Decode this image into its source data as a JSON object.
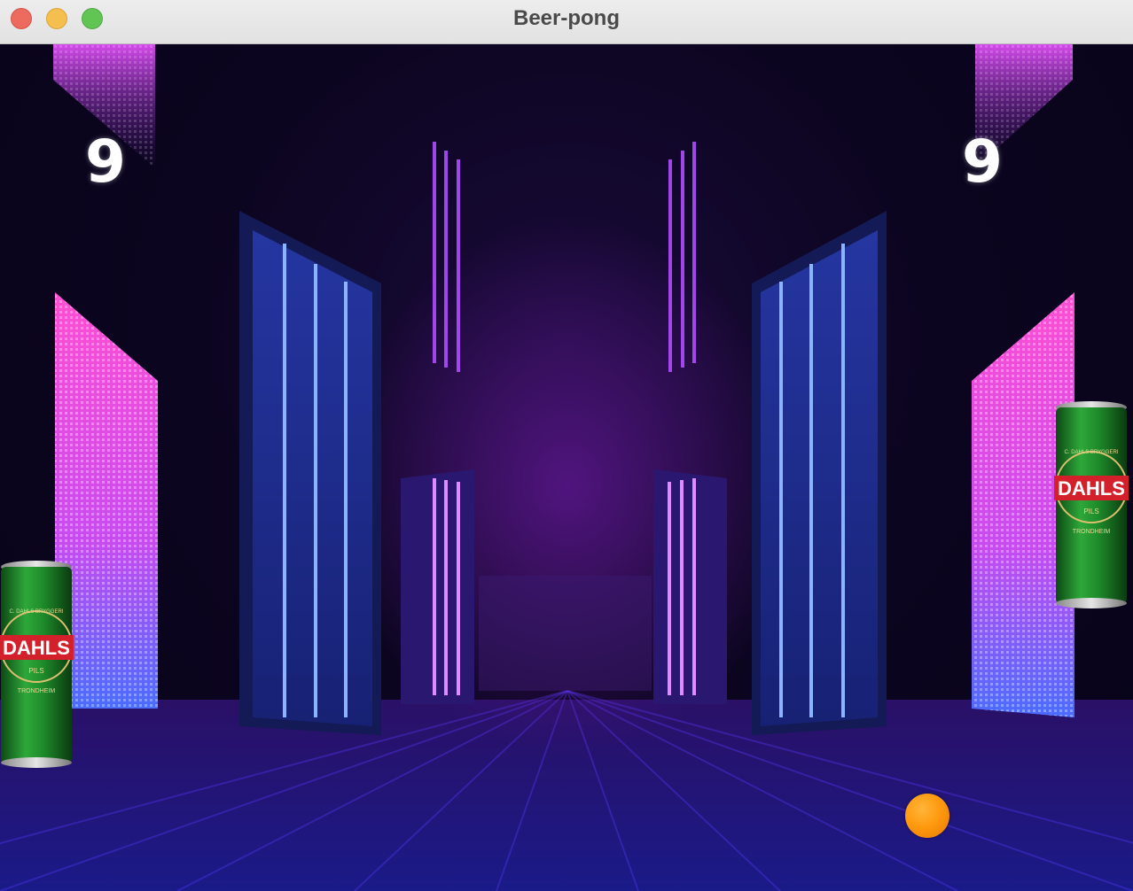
{
  "window": {
    "title": "Beer-pong",
    "controls": {
      "close_color": "#ec6a5e",
      "minimize_color": "#f4bf4f",
      "maximize_color": "#61c554"
    }
  },
  "game": {
    "score_left": "9",
    "score_right": "9",
    "paddle_left": {
      "brand": "DAHLS",
      "sub": "PILS",
      "city": "TRONDHEIM",
      "top": "C. DAHLS BRYGGERI"
    },
    "paddle_right": {
      "brand": "DAHLS",
      "sub": "PILS",
      "city": "TRONDHEIM",
      "top": "C. DAHLS BRYGGERI"
    },
    "ball_color": "#ff9a10",
    "background_theme": "neon corridor"
  }
}
